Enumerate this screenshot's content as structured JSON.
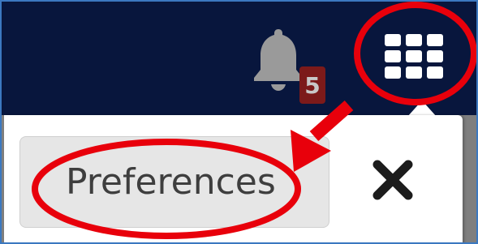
{
  "notifications": {
    "icon": "bell-icon",
    "count": "5",
    "badge_color": "#7c1a1a"
  },
  "apps_menu": {
    "icon": "apps-grid-icon"
  },
  "menu_panel": {
    "preferences_label": "Preferences",
    "close_icon": "close-icon"
  },
  "annotation": {
    "highlight_color": "#e8000b",
    "arrow_color": "#e8000b"
  },
  "theme": {
    "navbar_color": "#08163d",
    "frame_border_color": "#3b78c0"
  }
}
